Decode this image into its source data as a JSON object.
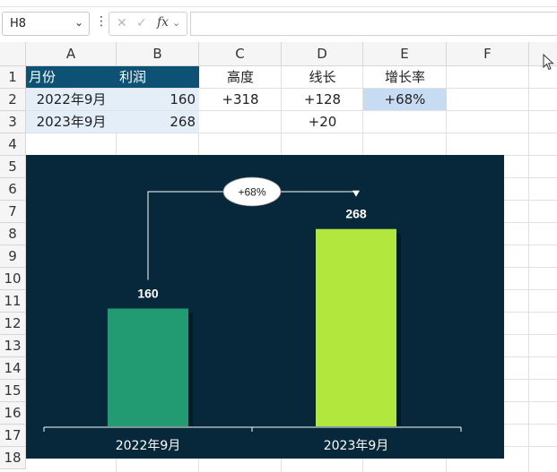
{
  "formula_bar": {
    "name_box": "H8",
    "fx": "fx",
    "formula": ""
  },
  "columns": [
    "A",
    "B",
    "C",
    "D",
    "E",
    "F"
  ],
  "rows": [
    "1",
    "2",
    "3",
    "4",
    "5",
    "6",
    "7",
    "8",
    "9",
    "10",
    "11",
    "12",
    "13",
    "14",
    "15",
    "16",
    "17",
    "18"
  ],
  "sheet": {
    "A1": "月份",
    "B1": "利润",
    "C1": "高度",
    "D1": "线长",
    "E1": "增长率",
    "A2": "2022年9月",
    "B2": "160",
    "C2": "+318",
    "D2": "+128",
    "E2": "+68%",
    "A3": "2023年9月",
    "B3": "268",
    "D3": "+20"
  },
  "chart_data": {
    "type": "bar",
    "categories": [
      "2022年9月",
      "2023年9月"
    ],
    "values": [
      160,
      268
    ],
    "value_labels": [
      "160",
      "268"
    ],
    "annotation": "+68%",
    "bar_colors": [
      "#239b72",
      "#b2e83e"
    ],
    "background": "#06283a"
  },
  "colors": {
    "header_fill": "#0d5275",
    "data_fill": "#e3eef8",
    "pct_fill": "#c7dcf2"
  }
}
